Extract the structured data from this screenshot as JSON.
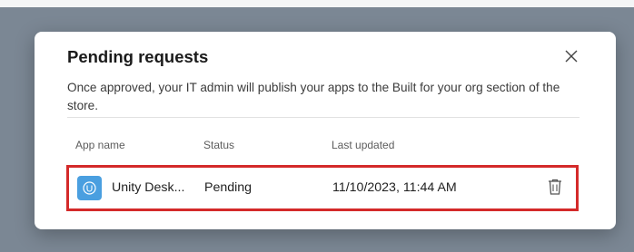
{
  "dialog": {
    "title": "Pending requests",
    "description": "Once approved, your IT admin will publish your apps to the Built for your org section of the store.",
    "close_icon": "close-icon"
  },
  "table": {
    "headers": {
      "app_name": "App name",
      "status": "Status",
      "last_updated": "Last updated"
    },
    "rows": [
      {
        "app_name": "Unity Desk...",
        "status": "Pending",
        "last_updated": "11/10/2023, 11:44 AM",
        "icon": "unity-app-icon",
        "action_icon": "trash-icon"
      }
    ]
  },
  "colors": {
    "highlight_border": "#d42a2a",
    "app_icon": "#4a9fe0",
    "backdrop": "#7b8794"
  }
}
